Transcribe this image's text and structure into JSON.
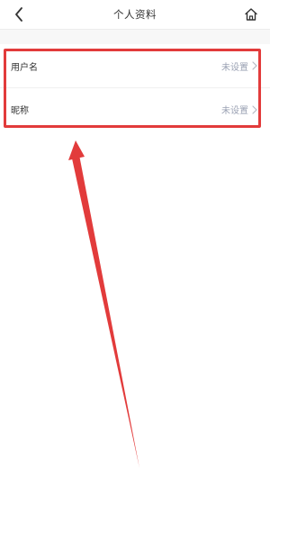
{
  "header": {
    "title": "个人资料",
    "back_icon": "chevron-left-icon",
    "home_icon": "home-icon"
  },
  "profile": {
    "rows": [
      {
        "label": "用户名",
        "value": "未设置"
      },
      {
        "label": "昵称",
        "value": "未设置"
      }
    ]
  },
  "annotation": {
    "highlight_color": "#e23b3b",
    "arrow_color": "#e23b3b"
  },
  "colors": {
    "value_text": "#9aa1b3",
    "label_text": "#333333"
  }
}
